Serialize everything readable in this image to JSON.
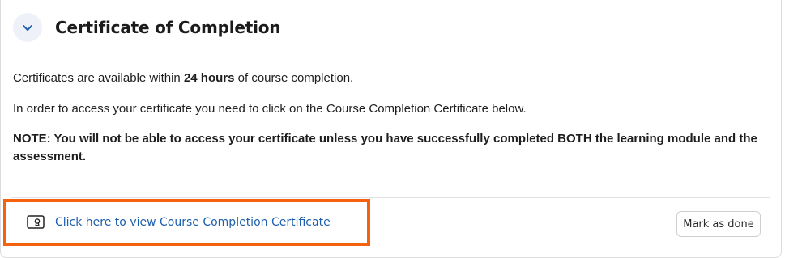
{
  "section": {
    "title": "Certificate of Completion",
    "toggle_icon": "chevron-down-icon",
    "accent_color": "#1c5fae"
  },
  "content": {
    "line1_pre": "Certificates are available within ",
    "line1_bold": "24 hours",
    "line1_post": " of course completion.",
    "line2": "In order to access your certificate you need to click on the Course Completion Certificate below.",
    "note": "NOTE: You will not be able to access your certificate unless you have successfully completed BOTH the learning module and the assessment."
  },
  "footer": {
    "certificate_link_label": "Click here to view Course Completion Certificate",
    "certificate_icon": "certificate-icon",
    "mark_done_label": "Mark as done",
    "highlight_color": "#f4620f"
  }
}
